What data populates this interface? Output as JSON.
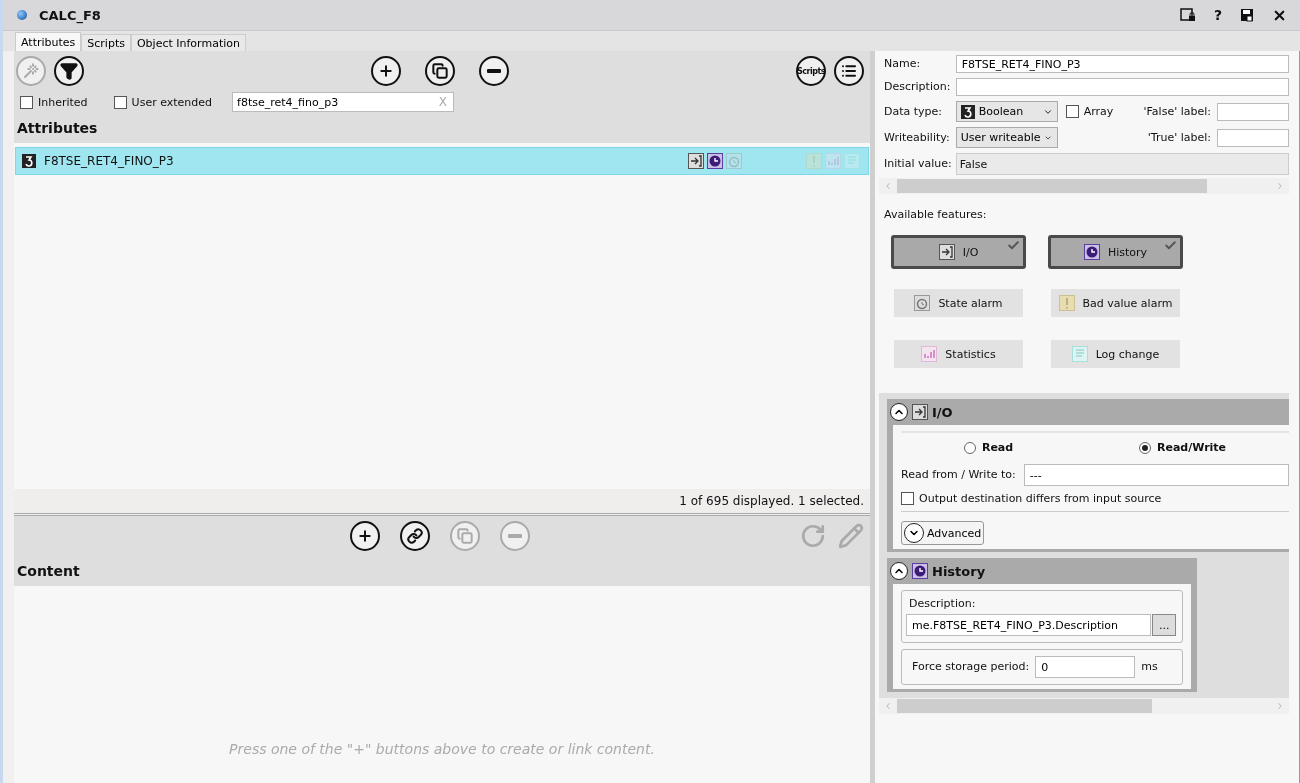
{
  "window": {
    "title": "CALC_F8",
    "help_label": "?"
  },
  "tabs": [
    {
      "label": "Attributes",
      "selected": true
    },
    {
      "label": "Scripts",
      "selected": false
    },
    {
      "label": "Object Information",
      "selected": false
    }
  ],
  "attribute_toolbar": {
    "left": [
      {
        "kind": "wand",
        "disabled": true
      },
      {
        "kind": "filter",
        "disabled": false
      }
    ],
    "center": [
      {
        "kind": "add",
        "disabled": false
      },
      {
        "kind": "duplicate",
        "disabled": false
      },
      {
        "kind": "remove",
        "disabled": false
      }
    ],
    "right": [
      {
        "kind": "scripts",
        "label": "Scripts",
        "disabled": false
      },
      {
        "kind": "list",
        "disabled": false
      }
    ]
  },
  "filters": [
    {
      "label": "Inherited",
      "checked": false
    },
    {
      "label": "User extended",
      "checked": false
    }
  ],
  "search": {
    "value": "f8tse_ret4_fino_p3",
    "clear_label": "X"
  },
  "attributes": {
    "heading": "Attributes",
    "rows": [
      {
        "name": "F8TSE_RET4_FINO_P3",
        "selected": true,
        "features": [
          {
            "kind": "io",
            "on": true
          },
          {
            "kind": "history",
            "on": true
          },
          {
            "kind": "state-alarm",
            "on": false
          },
          {
            "kind": "bad-value-alarm",
            "on": false
          },
          {
            "kind": "statistics",
            "on": false
          },
          {
            "kind": "log-change",
            "on": false
          }
        ]
      }
    ],
    "status": "1 of 695 displayed. 1 selected."
  },
  "content_toolbar": {
    "center": [
      {
        "kind": "add",
        "disabled": false
      },
      {
        "kind": "link-add",
        "disabled": false
      },
      {
        "kind": "duplicate",
        "disabled": true
      },
      {
        "kind": "remove",
        "disabled": true
      }
    ],
    "right": [
      {
        "kind": "refresh",
        "disabled": true
      },
      {
        "kind": "edit",
        "disabled": true
      }
    ]
  },
  "content": {
    "heading": "Content",
    "hint": "Press one of the \"+\" buttons above to create or link content."
  },
  "details": {
    "name": {
      "label": "Name:",
      "value": "F8TSE_RET4_FINO_P3"
    },
    "description": {
      "label": "Description:"
    },
    "data_type": {
      "label": "Data type:",
      "value": "Boolean"
    },
    "array": {
      "label": "Array",
      "checked": false
    },
    "false_label": {
      "label": "'False' label:"
    },
    "true_label": {
      "label": "'True' label:"
    },
    "writeability": {
      "label": "Writeability:",
      "value": "User writeable"
    },
    "initial_value": {
      "label": "Initial value:",
      "value": "False"
    }
  },
  "features": {
    "heading": "Available features:",
    "items": [
      {
        "kind": "io",
        "label": "I/O",
        "selected": true
      },
      {
        "kind": "history",
        "label": "History",
        "selected": true
      },
      {
        "kind": "state-alarm",
        "label": "State alarm",
        "selected": false
      },
      {
        "kind": "bad-value-alarm",
        "label": "Bad value alarm",
        "selected": false
      },
      {
        "kind": "statistics",
        "label": "Statistics",
        "selected": false
      },
      {
        "kind": "log-change",
        "label": "Log change",
        "selected": false
      }
    ]
  },
  "io_section": {
    "title": "I/O",
    "expanded": true,
    "modes": [
      {
        "label": "Read",
        "selected": false
      },
      {
        "label": "Read/Write",
        "selected": true
      }
    ],
    "address": {
      "label": "Read from / Write to:",
      "value": "---"
    },
    "output_differs": {
      "label": "Output destination differs from input source",
      "checked": false
    },
    "advanced": {
      "label": "Advanced",
      "expanded": false
    }
  },
  "history_section": {
    "title": "History",
    "expanded": true,
    "description": {
      "label": "Description:",
      "value": "me.F8TSE_RET4_FINO_P3.Description",
      "browse_label": "..."
    },
    "storage_period": {
      "label": "Force storage period:",
      "value": "0",
      "unit": "ms"
    }
  }
}
